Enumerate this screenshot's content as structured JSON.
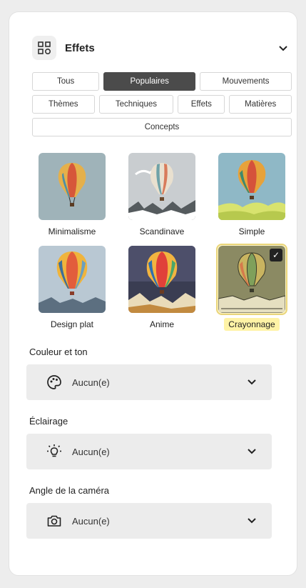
{
  "header": {
    "title": "Effets",
    "icon": "effects-grid-icon",
    "collapse_icon": "chevron-down-icon"
  },
  "filters": {
    "row1": [
      "Tous",
      "Populaires",
      "Mouvements"
    ],
    "row2": [
      "Thèmes",
      "Techniques",
      "Effets",
      "Matières"
    ],
    "row3": [
      "Concepts"
    ],
    "active": "Populaires"
  },
  "styles": [
    {
      "label": "Minimalisme",
      "selected": false
    },
    {
      "label": "Scandinave",
      "selected": false
    },
    {
      "label": "Simple",
      "selected": false
    },
    {
      "label": "Design plat",
      "selected": false
    },
    {
      "label": "Anime",
      "selected": false
    },
    {
      "label": "Crayonnage",
      "selected": true
    }
  ],
  "sections": {
    "color": {
      "label": "Couleur et ton",
      "value": "Aucun(e)",
      "icon": "palette-icon"
    },
    "lighting": {
      "label": "Éclairage",
      "value": "Aucun(e)",
      "icon": "lightbulb-icon"
    },
    "camera": {
      "label": "Angle de la caméra",
      "value": "Aucun(e)",
      "icon": "camera-icon"
    }
  },
  "colors": {
    "active_filter": "#4b4b4b",
    "selected_highlight": "#fff3a6",
    "dropdown_bg": "#ececec"
  }
}
